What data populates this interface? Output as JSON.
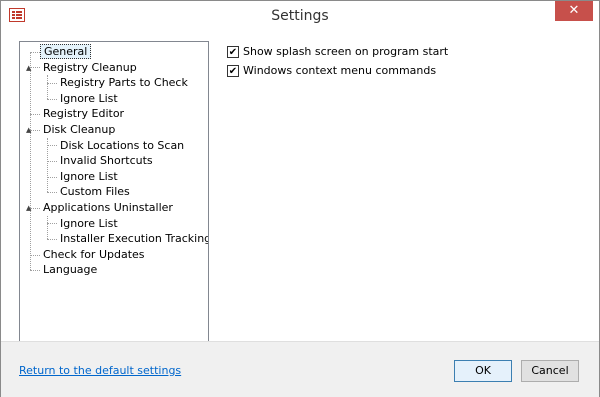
{
  "window": {
    "title": "Settings",
    "close_glyph": "✕"
  },
  "tree": {
    "items": [
      {
        "label": "General",
        "level": 0,
        "selected": true,
        "expander": ""
      },
      {
        "label": "Registry Cleanup",
        "level": 0,
        "selected": false,
        "expander": "▲"
      },
      {
        "label": "Registry Parts to Check",
        "level": 1,
        "selected": false,
        "expander": ""
      },
      {
        "label": "Ignore List",
        "level": 1,
        "selected": false,
        "expander": ""
      },
      {
        "label": "Registry Editor",
        "level": 0,
        "selected": false,
        "expander": ""
      },
      {
        "label": "Disk Cleanup",
        "level": 0,
        "selected": false,
        "expander": "▲"
      },
      {
        "label": "Disk Locations to Scan",
        "level": 1,
        "selected": false,
        "expander": ""
      },
      {
        "label": "Invalid Shortcuts",
        "level": 1,
        "selected": false,
        "expander": ""
      },
      {
        "label": "Ignore List",
        "level": 1,
        "selected": false,
        "expander": ""
      },
      {
        "label": "Custom Files",
        "level": 1,
        "selected": false,
        "expander": ""
      },
      {
        "label": "Applications Uninstaller",
        "level": 0,
        "selected": false,
        "expander": "▲"
      },
      {
        "label": "Ignore List",
        "level": 1,
        "selected": false,
        "expander": ""
      },
      {
        "label": "Installer Execution Tracking",
        "level": 1,
        "selected": false,
        "expander": ""
      },
      {
        "label": "Check for Updates",
        "level": 0,
        "selected": false,
        "expander": ""
      },
      {
        "label": "Language",
        "level": 0,
        "selected": false,
        "expander": ""
      }
    ]
  },
  "options": {
    "checkboxes": [
      {
        "label": "Show splash screen on program start",
        "checked": true
      },
      {
        "label": "Windows context menu commands",
        "checked": true
      }
    ],
    "check_glyph": "✔"
  },
  "footer": {
    "reset_link": "Return to the default settings",
    "ok_label": "OK",
    "cancel_label": "Cancel"
  }
}
